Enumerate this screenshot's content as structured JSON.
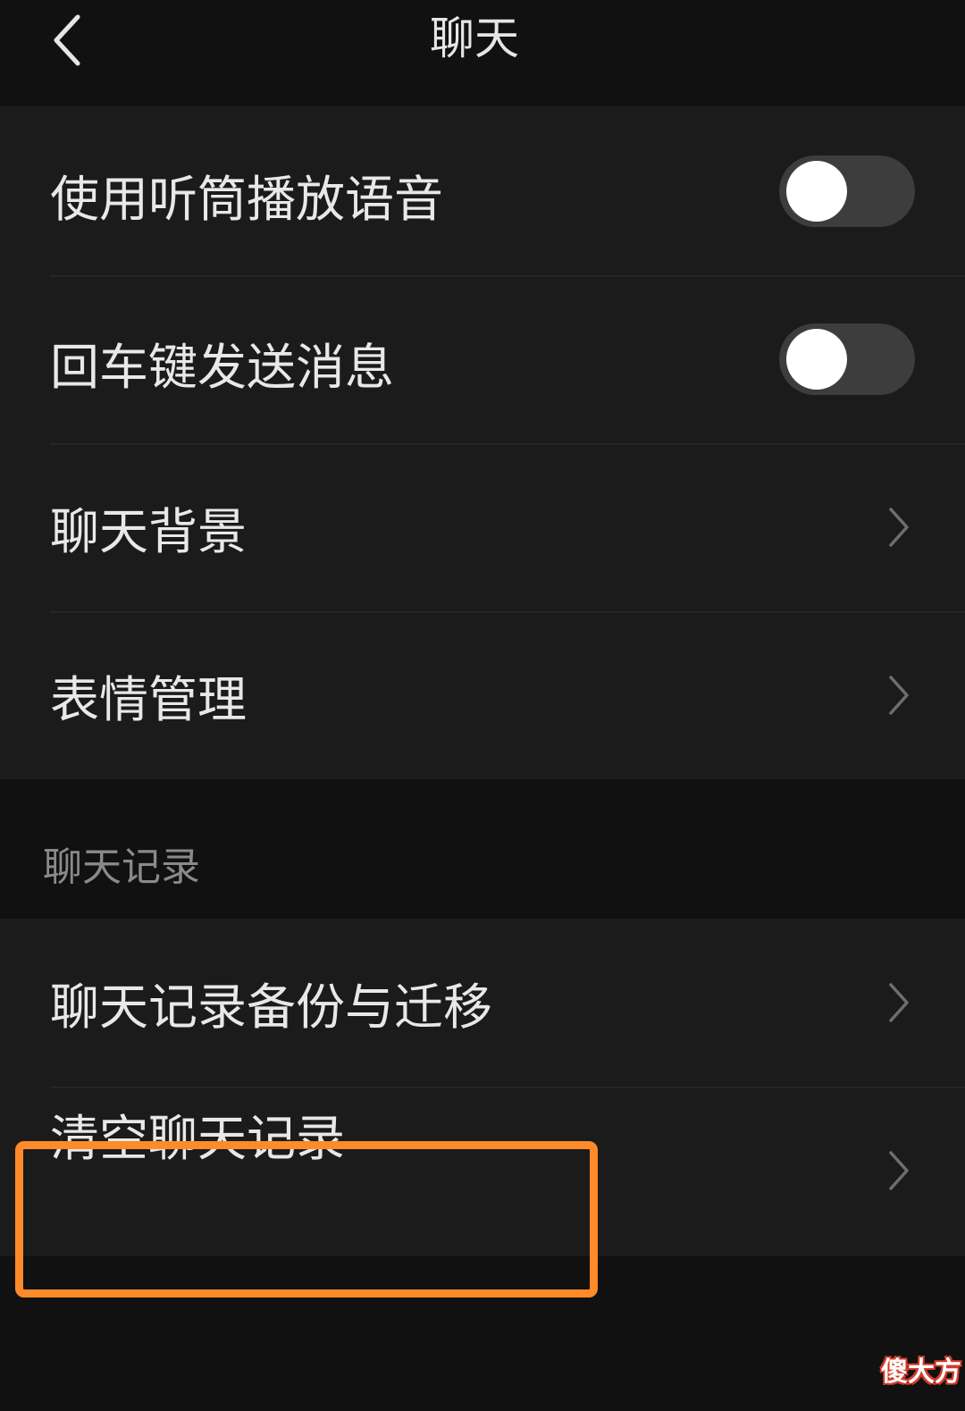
{
  "header": {
    "title": "聊天",
    "back_icon": "chevron-left-icon"
  },
  "settings": {
    "items": [
      {
        "label": "使用听筒播放语音",
        "type": "toggle",
        "checked": false
      },
      {
        "label": "回车键发送消息",
        "type": "toggle",
        "checked": false
      },
      {
        "label": "聊天背景",
        "type": "link",
        "icon": "chevron-right-icon"
      },
      {
        "label": "表情管理",
        "type": "link",
        "icon": "chevron-right-icon"
      }
    ]
  },
  "chat_history": {
    "section_title": "聊天记录",
    "items": [
      {
        "label": "聊天记录备份与迁移",
        "type": "link",
        "icon": "chevron-right-icon"
      },
      {
        "label": "清空聊天记录",
        "type": "link",
        "icon": "chevron-right-icon",
        "highlighted": true
      }
    ]
  },
  "annotation": {
    "highlight_color": "#ff8a2a"
  },
  "watermark": {
    "text": "傻大方"
  },
  "colors": {
    "background": "#111111",
    "group_background": "#1b1b1b",
    "toggle_track_off": "#3d3d3d",
    "toggle_knob": "#ffffff"
  }
}
